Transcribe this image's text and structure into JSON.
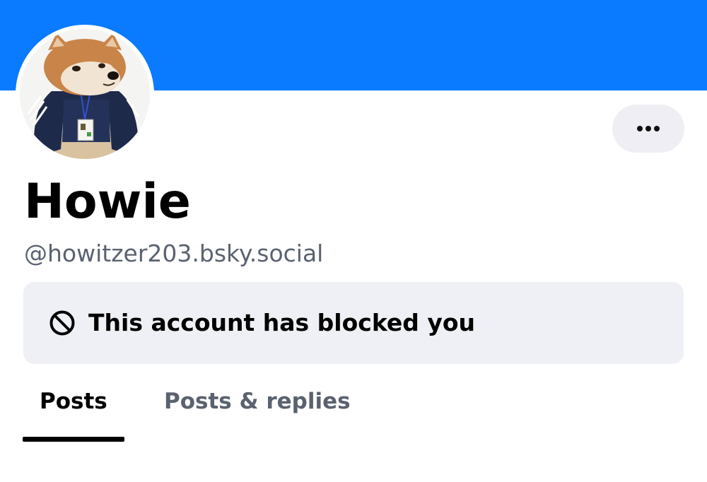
{
  "profile": {
    "display_name": "Howie",
    "handle": "@howitzer203.bsky.social"
  },
  "blocked_notice": {
    "icon": "block-icon",
    "text": "This account has blocked you"
  },
  "more_button": {
    "icon": "more-horizontal-icon"
  },
  "tabs": [
    {
      "label": "Posts",
      "selected": true
    },
    {
      "label": "Posts & replies",
      "selected": false
    }
  ],
  "colors": {
    "banner": "#0a7aff",
    "notice_background": "#eff0f5",
    "secondary_text": "#5a6270"
  }
}
